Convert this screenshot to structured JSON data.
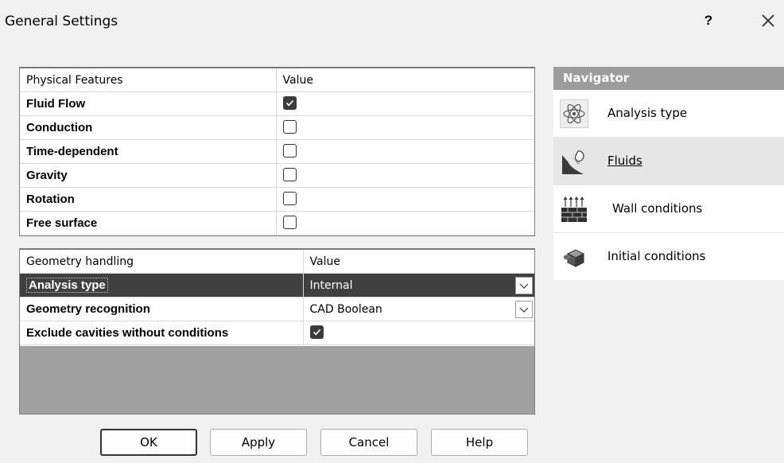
{
  "window": {
    "title": "General Settings",
    "help_label": "?"
  },
  "physical_features": {
    "header_name": "Physical Features",
    "header_value": "Value",
    "rows": [
      {
        "label": "Fluid Flow",
        "checked": true
      },
      {
        "label": "Conduction",
        "checked": false
      },
      {
        "label": "Time-dependent",
        "checked": false
      },
      {
        "label": "Gravity",
        "checked": false
      },
      {
        "label": "Rotation",
        "checked": false
      },
      {
        "label": "Free surface",
        "checked": false
      }
    ]
  },
  "geometry_handling": {
    "header_name": "Geometry handling",
    "header_value": "Value",
    "rows": [
      {
        "label": "Analysis type",
        "value": "Internal",
        "selected": true
      },
      {
        "label": "Geometry recognition",
        "value": "CAD Boolean"
      },
      {
        "label": "Exclude cavities without conditions",
        "checked": true
      }
    ]
  },
  "buttons": {
    "ok": "OK",
    "apply": "Apply",
    "cancel": "Cancel",
    "help": "Help"
  },
  "navigator": {
    "title": "Navigator",
    "items": [
      {
        "label": "Analysis type",
        "icon": "analysis-type-icon"
      },
      {
        "label": "Fluids",
        "icon": "fluids-icon",
        "active": true
      },
      {
        "label": "Wall conditions",
        "icon": "wall-conditions-icon"
      },
      {
        "label": "Initial conditions",
        "icon": "initial-conditions-icon"
      }
    ]
  },
  "colors": {
    "selected_row": "#404040",
    "navigator_header": "#9c9c9c",
    "dialog_bg": "#f0f0f0"
  }
}
